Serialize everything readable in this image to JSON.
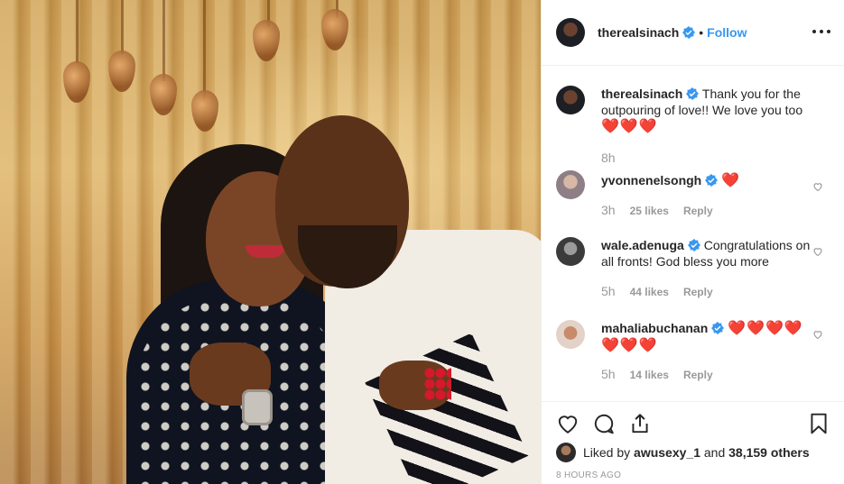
{
  "post": {
    "username": "therealsinach",
    "follow_separator": "•",
    "follow_label": "Follow"
  },
  "icons": {
    "verified": "verified-badge-icon",
    "more": "more-options-icon",
    "like": "heart-outline-icon",
    "comment": "comment-bubble-icon",
    "share": "share-icon",
    "save": "bookmark-icon"
  },
  "colors": {
    "link": "#3897f0",
    "heart": "#ed4956",
    "muted": "#999999",
    "text": "#262626",
    "border": "#efefef"
  },
  "caption": {
    "username": "therealsinach",
    "text": "Thank you for the outpouring of love!! We love you too",
    "emoji": "❤️❤️❤️",
    "time": "8h"
  },
  "comments": [
    {
      "username": "yvonnenelsongh",
      "text": "",
      "emoji": "❤️",
      "time": "3h",
      "likes": "25 likes",
      "reply": "Reply"
    },
    {
      "username": "wale.adenuga",
      "text": "Congratulations on all fronts! God bless you more",
      "emoji": "",
      "time": "5h",
      "likes": "44 likes",
      "reply": "Reply"
    },
    {
      "username": "mahaliabuchanan",
      "text": "",
      "emoji": "❤️❤️❤️❤️❤️❤️❤️",
      "time": "5h",
      "likes": "14 likes",
      "reply": "Reply"
    }
  ],
  "likes": {
    "prefix": "Liked by",
    "user": "awusexy_1",
    "middle": "and",
    "others": "38,159 others"
  },
  "timestamp": "8 HOURS AGO"
}
